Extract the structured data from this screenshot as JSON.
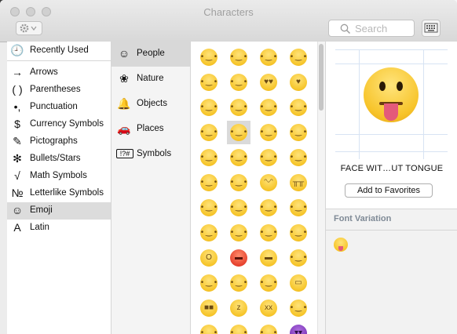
{
  "window": {
    "title": "Characters"
  },
  "toolbar": {
    "search_placeholder": "Search"
  },
  "categories": [
    {
      "label": "Recently Used",
      "icon": "clock-icon",
      "glyph": "🕘"
    },
    {
      "label": "Arrows",
      "icon": "arrow-icon",
      "glyph": "→"
    },
    {
      "label": "Parentheses",
      "icon": "parentheses-icon",
      "glyph": "( )"
    },
    {
      "label": "Punctuation",
      "icon": "punctuation-icon",
      "glyph": "•,"
    },
    {
      "label": "Currency Symbols",
      "icon": "dollar-icon",
      "glyph": "$"
    },
    {
      "label": "Pictographs",
      "icon": "pictograph-icon",
      "glyph": "✎"
    },
    {
      "label": "Bullets/Stars",
      "icon": "star-icon",
      "glyph": "✻"
    },
    {
      "label": "Math Symbols",
      "icon": "sqrt-icon",
      "glyph": "√"
    },
    {
      "label": "Letterlike Symbols",
      "icon": "numero-icon",
      "glyph": "№"
    },
    {
      "label": "Emoji",
      "icon": "smiley-icon",
      "glyph": "☺",
      "selected": true
    },
    {
      "label": "Latin",
      "icon": "letter-a-icon",
      "glyph": "A"
    }
  ],
  "subcategories": [
    {
      "label": "People",
      "icon": "smiley-icon",
      "glyph": "☺",
      "selected": true
    },
    {
      "label": "Nature",
      "icon": "flower-icon",
      "glyph": "❀"
    },
    {
      "label": "Objects",
      "icon": "bell-icon",
      "glyph": "🔔"
    },
    {
      "label": "Places",
      "icon": "car-icon",
      "glyph": "🚗"
    },
    {
      "label": "Symbols",
      "icon": "symbols-icon",
      "glyph": "!?#"
    }
  ],
  "emoji_rows": [
    [
      "grinning-face",
      "smiling-face",
      "grinning-face-eyes",
      "smiling-blush"
    ],
    [
      "relieved-face",
      "winking-face",
      "heart-eyes-face",
      "kissing-heart-face"
    ],
    [
      "kissing-face",
      "kissing-face",
      "kissing-smiling-eyes",
      "tongue-wink-face"
    ],
    [
      "tongue-closed-eyes",
      "tongue-face",
      "flushed-face",
      "grimacing-face"
    ],
    [
      "pensive-face",
      "relieved-face",
      "unamused-face",
      "disappointed-face"
    ],
    [
      "persevering-face",
      "crying-face",
      "tears-of-joy",
      "sobbing-face"
    ],
    [
      "sleepy-face",
      "disappointed-relieved",
      "cold-sweat-face",
      "sweat-smile"
    ],
    [
      "sweat-face",
      "weary-face",
      "tired-face",
      "fearful-face"
    ],
    [
      "screaming-face",
      "angry-face",
      "pouting-face",
      "triumph-face"
    ],
    [
      "confounded-face",
      "laughing-face",
      "yum-face",
      "mask-face"
    ],
    [
      "sunglasses-face",
      "sleeping-face",
      "dizzy-face",
      "astonished-face"
    ],
    [
      "worried-face",
      "frowning-face",
      "anguished-face",
      "imp-face"
    ]
  ],
  "detail": {
    "char_name": "FACE WIT…UT TONGUE",
    "favorites_button": "Add to Favorites",
    "font_variation_title": "Font Variation"
  }
}
